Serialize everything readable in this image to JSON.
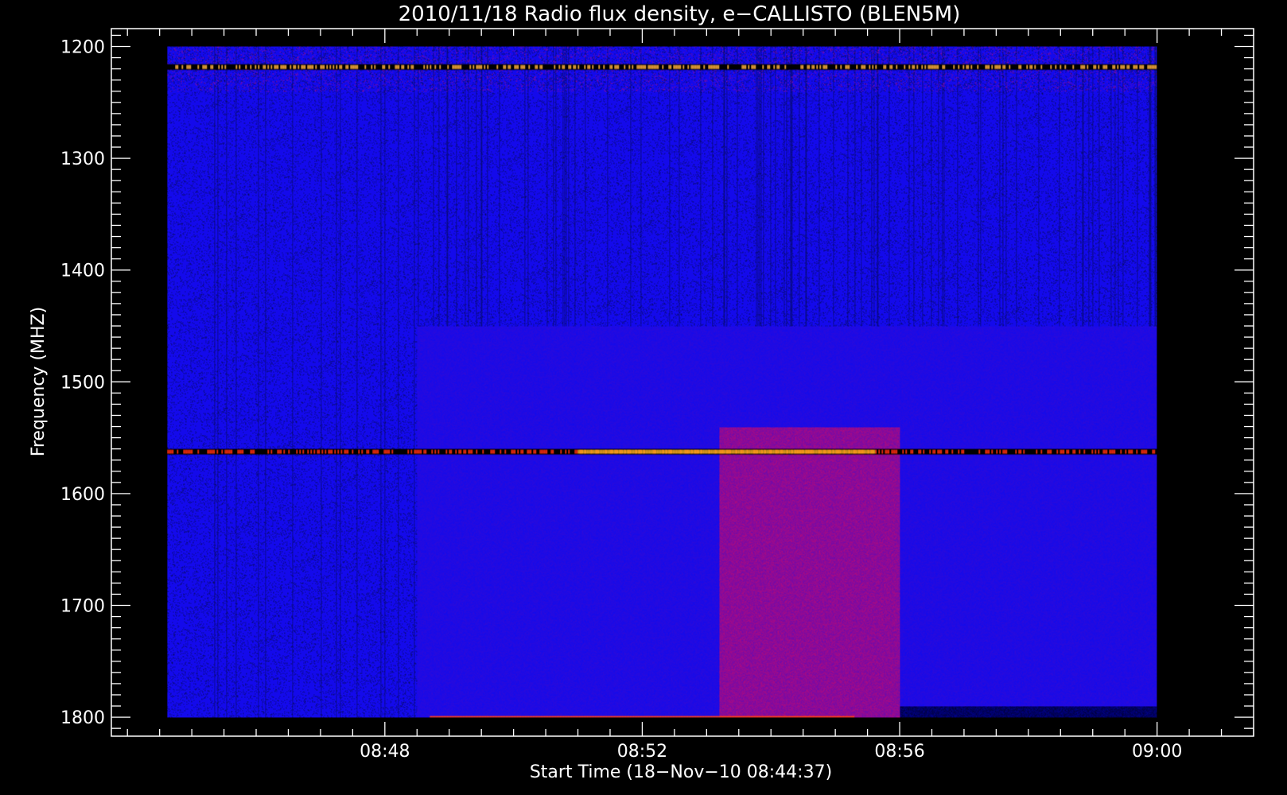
{
  "chart_data": {
    "type": "heatmap",
    "title": "2010/11/18  Radio flux density, e−CALLISTO (BLEN5M)",
    "xlabel": "Start Time (18−Nov−10 08:44:37)",
    "ylabel": "Frequency (MHZ)",
    "x_ticks": [
      "08:48",
      "08:52",
      "08:56",
      "09:00"
    ],
    "x_tick_minutes": [
      48,
      52,
      56,
      60
    ],
    "y_ticks": [
      1200,
      1300,
      1400,
      1500,
      1600,
      1700,
      1800
    ],
    "xlim_minutes": [
      43.75,
      61.5
    ],
    "data_start_minutes": 44.62,
    "data_end_minutes": 60.0,
    "ylim": [
      1184,
      1817
    ],
    "y_inverted": true,
    "frequency_range": [
      1200,
      1800
    ],
    "colormap": [
      "#000000",
      "#0a00ff",
      "#d01818",
      "#ffd060"
    ],
    "background_color": "#1414e8",
    "features": [
      {
        "type": "constant-band",
        "frequency": 1218,
        "time_range": [
          44.62,
          60.0
        ],
        "color": "#ffb040"
      },
      {
        "type": "constant-band",
        "frequency": 1562,
        "time_range": [
          44.62,
          60.0
        ],
        "color": "#ff3010"
      },
      {
        "type": "burst-band",
        "frequency": 1562,
        "time_range": [
          51.0,
          55.6
        ],
        "color": "#ffb020"
      },
      {
        "type": "burst-band",
        "frequency": 1800,
        "time_range": [
          48.7,
          55.3
        ],
        "color": "#ff4010"
      },
      {
        "type": "diffuse-emission",
        "frequency_range": [
          1540,
          1800
        ],
        "time_range": [
          53.2,
          56.0
        ],
        "color": "#a0207a"
      }
    ]
  }
}
